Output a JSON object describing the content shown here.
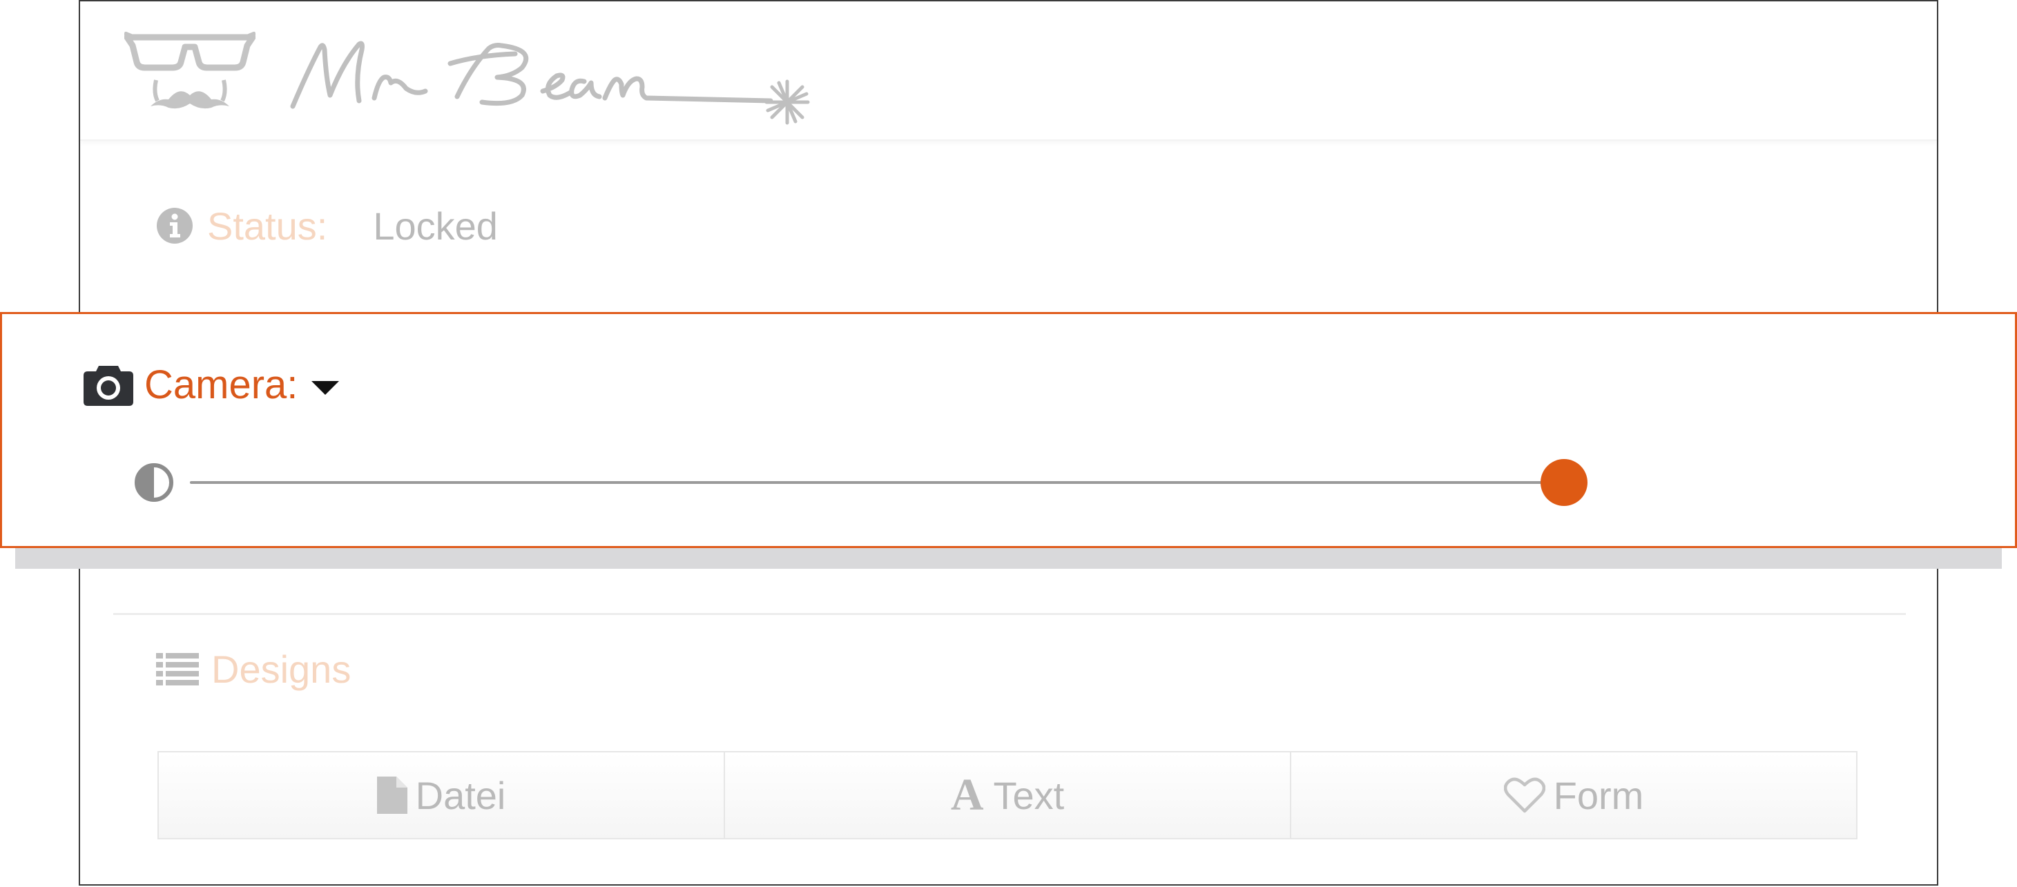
{
  "header": {
    "logo_icon": "glasses-mustache-logo",
    "wordmark_icon": "mr-beam-wordmark"
  },
  "status": {
    "icon": "info-circle-icon",
    "label": "Status:",
    "value": "Locked"
  },
  "camera": {
    "icon": "camera-icon",
    "label": "Camera:",
    "dropdown_icon": "caret-down-icon",
    "contrast_icon": "contrast-icon",
    "slider_value_fraction": 1.0
  },
  "designs": {
    "icon": "list-icon",
    "label": "Designs",
    "tabs": [
      {
        "label": "Datei",
        "icon": "file-icon"
      },
      {
        "label": "Text",
        "icon": "font-icon"
      },
      {
        "label": "Form",
        "icon": "heart-icon"
      }
    ]
  },
  "colors": {
    "accent": "#de5a14",
    "accent_text": "#d9581a",
    "faded_accent": "#f6d6c0",
    "faded_text": "#b9b9b9",
    "highlight_border": "#e05a1a"
  }
}
